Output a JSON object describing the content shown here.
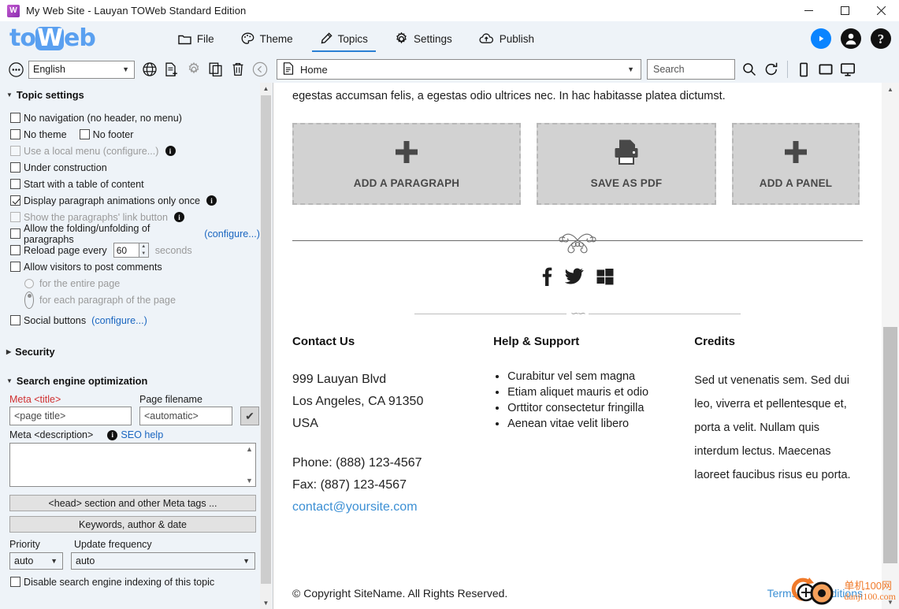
{
  "window": {
    "title": "My Web Site - Lauyan TOWeb Standard Edition",
    "app_icon": "W",
    "minimize": "—",
    "maximize": "□",
    "close": "✕"
  },
  "brand": {
    "prefix": "to",
    "mark": "W",
    "suffix": "eb"
  },
  "nav": {
    "items": [
      {
        "label": "File",
        "icon": "folder-icon",
        "active": false
      },
      {
        "label": "Theme",
        "icon": "palette-icon",
        "active": false
      },
      {
        "label": "Topics",
        "icon": "pencil-icon",
        "active": true
      },
      {
        "label": "Settings",
        "icon": "gear-icon",
        "active": false
      },
      {
        "label": "Publish",
        "icon": "cloud-upload-icon",
        "active": false
      }
    ],
    "right_icons": [
      "play-icon",
      "account-icon",
      "help-icon"
    ]
  },
  "toolbar": {
    "more_icon": "more-options-icon",
    "language": "English",
    "icons": [
      "globe-icon",
      "new-page-icon",
      "gear-icon",
      "copy-icon",
      "trash-icon",
      "back-icon"
    ],
    "topic": "Home",
    "topic_icon": "page-icon",
    "search_placeholder": "Search",
    "search_value": "",
    "right_icons": [
      "search-icon",
      "refresh-icon",
      "phone-preview-icon",
      "tablet-preview-icon",
      "desktop-preview-icon"
    ]
  },
  "left_panel": {
    "topic_settings": {
      "title": "Topic settings",
      "expanded": true,
      "options": [
        {
          "label": "No navigation (no header, no menu)",
          "checked": false,
          "disabled": false,
          "info": false
        },
        {
          "label": "No theme",
          "checked": false,
          "disabled": false,
          "info": false
        },
        {
          "label": "No footer",
          "checked": false,
          "disabled": false,
          "info": false
        },
        {
          "label": "Use a local menu (configure...)",
          "checked": false,
          "disabled": true,
          "info": true
        },
        {
          "label": "Under construction",
          "checked": false,
          "disabled": false,
          "info": false
        },
        {
          "label": "Start with a table of content",
          "checked": false,
          "disabled": false,
          "info": false
        },
        {
          "label": "Display paragraph animations only once",
          "checked": true,
          "disabled": false,
          "info": true
        },
        {
          "label": "Show the paragraphs' link button",
          "checked": false,
          "disabled": true,
          "info": true
        }
      ],
      "folding": {
        "label": "Allow the folding/unfolding of paragraphs",
        "link": "(configure...)",
        "checked": false
      },
      "reload": {
        "label": "Reload page every",
        "value": "60",
        "unit": "seconds",
        "checked": false
      },
      "comments": {
        "label": "Allow visitors to post comments",
        "checked": false,
        "radios": [
          {
            "label": "for the entire page",
            "selected": false
          },
          {
            "label": "for each paragraph of the page",
            "selected": true
          }
        ]
      },
      "social": {
        "label": "Social buttons",
        "link": "(configure...)",
        "checked": false
      }
    },
    "security": {
      "title": "Security",
      "expanded": false
    },
    "seo": {
      "title": "Search engine optimization",
      "expanded": true,
      "meta_title_label": "Meta <title>",
      "meta_title_placeholder": "<page title>",
      "meta_title_value": "",
      "page_filename_label": "Page filename",
      "page_filename_placeholder": "<automatic>",
      "page_filename_value": "",
      "ok_icon": "check-icon",
      "meta_desc_label": "Meta <description>",
      "meta_desc_value": "",
      "seo_help": "SEO help",
      "head_button": "<head> section and other Meta tags ...",
      "keywords_button": "Keywords, author & date",
      "priority_label": "Priority",
      "priority_value": "auto",
      "update_freq_label": "Update frequency",
      "update_freq_value": "auto",
      "disable_index": {
        "label": "Disable search engine indexing of this topic",
        "checked": false
      }
    }
  },
  "preview": {
    "intro_text": "egestas accumsan felis, a egestas odio ultrices nec. In hac habitasse platea dictumst.",
    "action_boxes": [
      {
        "caption": "ADD A PARAGRAPH",
        "icon": "plus-icon"
      },
      {
        "caption": "SAVE AS PDF",
        "icon": "printer-icon"
      },
      {
        "caption": "ADD A PANEL",
        "icon": "plus-icon"
      }
    ],
    "social_icons": [
      "facebook-icon",
      "twitter-icon",
      "windows-icon"
    ],
    "columns": [
      {
        "heading": "Contact Us",
        "type": "contact",
        "address": [
          "999 Lauyan Blvd",
          "Los Angeles, CA 91350",
          "USA"
        ],
        "phones": [
          "Phone: (888) 123-4567",
          "Fax: (887) 123-4567"
        ],
        "email": "contact@yoursite.com"
      },
      {
        "heading": "Help & Support",
        "type": "list",
        "items": [
          "Curabitur vel sem magna",
          "Etiam aliquet mauris et odio",
          "Orttitor consectetur fringilla",
          "Aenean vitae velit libero"
        ]
      },
      {
        "heading": "Credits",
        "type": "text",
        "text": "Sed ut venenatis sem. Sed dui leo, viverra et pellentesque et, porta a velit. Nullam quis interdum lectus. Maecenas laoreet faucibus risus eu porta."
      }
    ],
    "copyright": "© Copyright SiteName. All Rights Reserved.",
    "terms": "Terms & Conditions"
  },
  "watermark": {
    "line1": "单机100网",
    "line2": "danji100.com"
  },
  "colors": {
    "accent": "#2a7fd4",
    "brand": "#5aa0f0",
    "panel_bg": "#eef3f8",
    "link": "#1a66c0",
    "required": "#d03030",
    "watermark": "#f07a2a"
  }
}
